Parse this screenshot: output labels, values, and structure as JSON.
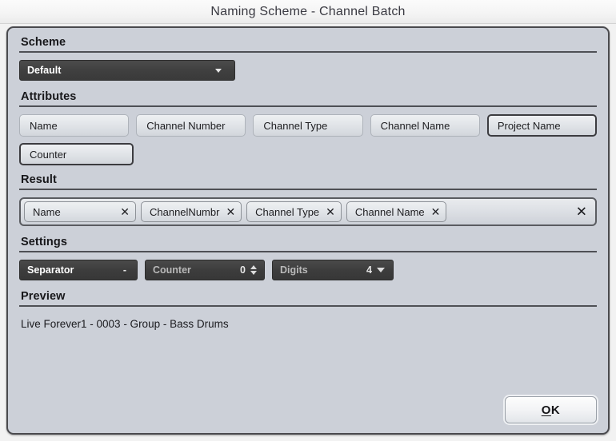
{
  "window": {
    "title": "Naming Scheme - Channel Batch"
  },
  "scheme": {
    "heading": "Scheme",
    "selected": "Default"
  },
  "attributes": {
    "heading": "Attributes",
    "row1": [
      {
        "label": "Name"
      },
      {
        "label": "Channel Number"
      },
      {
        "label": "Channel Type"
      },
      {
        "label": "Channel Name"
      },
      {
        "label": "Project Name"
      }
    ],
    "row2": [
      {
        "label": "Counter"
      }
    ]
  },
  "result": {
    "heading": "Result",
    "chips": [
      {
        "label": "Name",
        "remove": "✕"
      },
      {
        "label": "ChannelNumbr",
        "remove": "✕"
      },
      {
        "label": "Channel Type",
        "remove": "✕"
      },
      {
        "label": "Channel Name",
        "remove": "✕"
      }
    ],
    "clear_all": "✕"
  },
  "settings": {
    "heading": "Settings",
    "separator": {
      "label": "Separator",
      "value": "-"
    },
    "counter": {
      "label": "Counter",
      "value": "0"
    },
    "digits": {
      "label": "Digits",
      "value": "4"
    }
  },
  "preview": {
    "heading": "Preview",
    "text": "Live Forever1 - 0003 - Group - Bass Drums"
  },
  "footer": {
    "ok_label": "OK"
  },
  "colors": {
    "dialog_background": "#ccd0d8",
    "dialog_border": "#4a4a4e",
    "dark_field": "#3d3d3d",
    "rule": "#4e5055",
    "text": "#17171a"
  }
}
